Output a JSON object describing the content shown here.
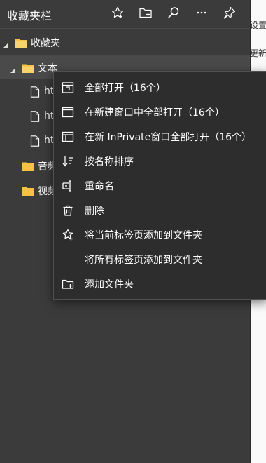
{
  "background_page": {
    "snippet_top": "设置",
    "snippet_bottom": "更新标"
  },
  "favorites_pane": {
    "title": "收藏夹栏",
    "toolbar": [
      {
        "name": "add-favorite-button",
        "icon": "star-icon"
      },
      {
        "name": "add-folder-button",
        "icon": "folder-add-icon"
      },
      {
        "name": "search-favorites-button",
        "icon": "search-icon"
      },
      {
        "name": "more-options-button",
        "icon": "more-icon"
      },
      {
        "name": "pin-pane-button",
        "icon": "pin-icon"
      }
    ],
    "tree": {
      "root": "收藏夹",
      "folder_text": "文本",
      "file_1": "ht",
      "file_2": "ht",
      "file_3": "ht",
      "folder_music": "音频",
      "folder_video": "视频"
    },
    "colors": {
      "pane_bg": "#3b3b3b",
      "menu_bg": "#2d2d2d",
      "folder": "#f7c144"
    }
  },
  "context_menu": {
    "items": [
      {
        "icon": "open-all-icon",
        "label": "全部打开（16个）"
      },
      {
        "icon": "new-window-icon",
        "label": "在新建窗口中全部打开（16个）"
      },
      {
        "icon": "inprivate-window-icon",
        "label": "在新 InPrivate窗口全部打开（16个）"
      },
      {
        "icon": "sort-icon",
        "label": "按名称排序"
      },
      {
        "icon": "rename-icon",
        "label": "重命名"
      },
      {
        "icon": "delete-icon",
        "label": "删除"
      },
      {
        "icon": "star-add-icon",
        "label": "将当前标签页添加到文件夹"
      },
      {
        "icon": "",
        "label": "将所有标签页添加到文件夹"
      },
      {
        "icon": "folder-add-icon",
        "label": "添加文件夹"
      }
    ]
  }
}
